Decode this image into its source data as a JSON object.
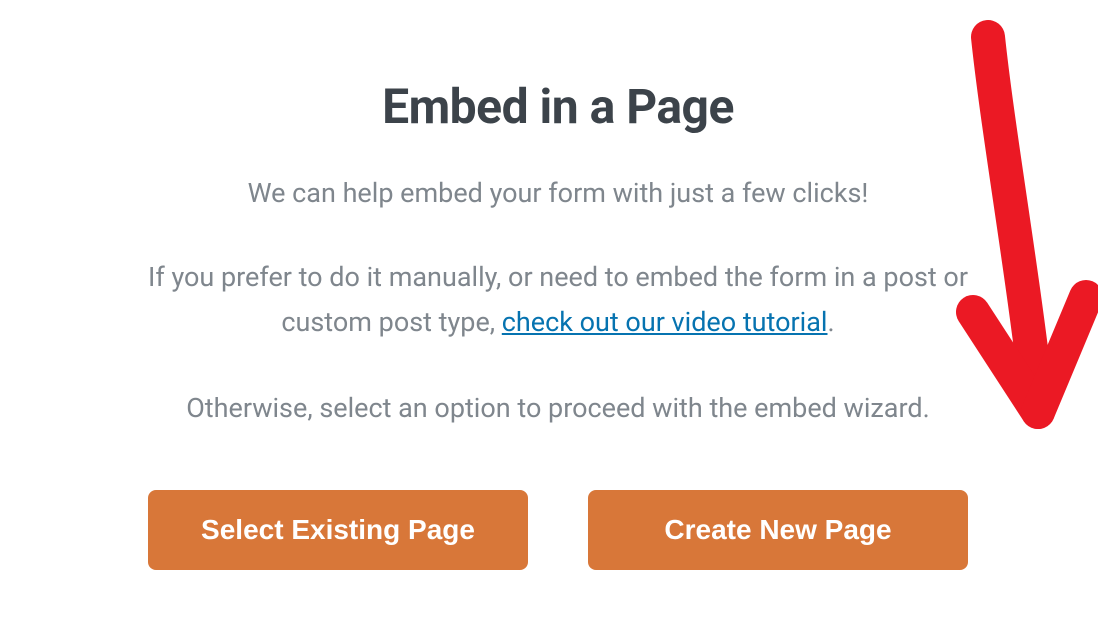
{
  "modal": {
    "title": "Embed in a Page",
    "subtitle": "We can help embed your form with just a few clicks!",
    "paragraph_prefix": "If you prefer to do it manually, or need to embed the form in a post or custom post type, ",
    "link_text": "check out our video tutorial",
    "paragraph_suffix": ".",
    "paragraph2": "Otherwise, select an option to proceed with the embed wizard.",
    "buttons": {
      "select_existing": "Select Existing Page",
      "create_new": "Create New Page"
    }
  },
  "colors": {
    "title": "#3c434a",
    "body_text": "#7f868d",
    "link": "#0673b0",
    "button_bg": "#d87739",
    "button_text": "#ffffff",
    "annotation": "#eb1924"
  }
}
